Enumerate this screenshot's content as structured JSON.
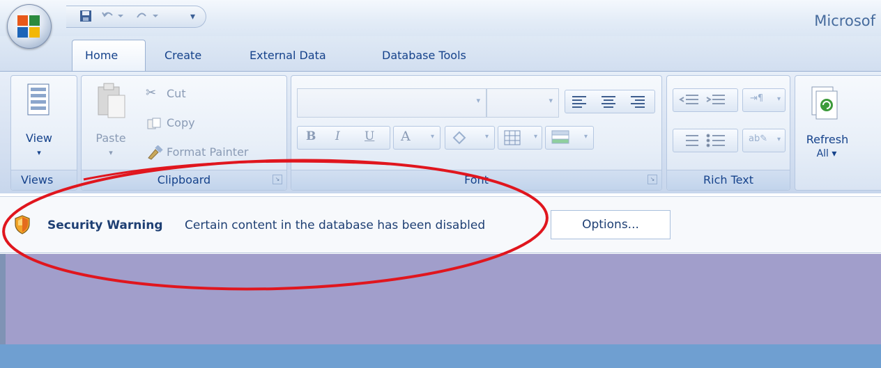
{
  "app_title": "Microsof",
  "quick_access": {
    "save_icon": "save-icon",
    "undo_icon": "undo-icon",
    "redo_icon": "redo-icon",
    "customize_glyph": "▾"
  },
  "tabs": [
    {
      "label": "Home",
      "active": true
    },
    {
      "label": "Create"
    },
    {
      "label": "External Data"
    },
    {
      "label": "Database Tools"
    }
  ],
  "groups": {
    "views": {
      "label": "Views",
      "view_label": "View",
      "view_arrow": "▾"
    },
    "clipboard": {
      "label": "Clipboard",
      "paste_label": "Paste",
      "paste_arrow": "▾",
      "cut_label": "Cut",
      "copy_label": "Copy",
      "format_painter_label": "Format Painter"
    },
    "font": {
      "label": "Font",
      "bold": "B",
      "italic": "I",
      "underline": "U",
      "font_color": "A"
    },
    "rich_text": {
      "label": "Rich Text"
    },
    "records": {
      "refresh_label": "Refresh",
      "refresh_all_label": "All ▾"
    }
  },
  "security_bar": {
    "title": "Security Warning",
    "message": "Certain content in the database has been disabled",
    "options_button": "Options..."
  },
  "colors": {
    "accent_text": "#15428b",
    "annotation": "#e0161e",
    "workspace": "#a19ecb",
    "bottom_bar": "#6f9fd1"
  }
}
